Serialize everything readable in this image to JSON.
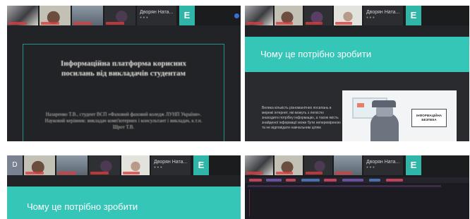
{
  "panels": [
    {
      "strip": {
        "name_label": "Дворян Ната...",
        "e_label": "E"
      },
      "slide": {
        "title": "Інформаційна платформа корисних посилань від викладачів студентам",
        "authors": "Назаренко Т.В., студент ВСП «Фаховий фаховий коледж ЛУНП України». Науковий керівник: викладач комп'ютерних і консультант і викладач, к.т.н. Шрот Т.В."
      }
    },
    {
      "strip": {
        "name_label": "Дворян Ната...",
        "e_label": "E"
      },
      "slide": {
        "heading": "Чому це потрібно зробити",
        "paragraph": "Велика кількість різноманітних посилань в мережі інтернет, які можуть з легкістю знаходити потрібну інформацію, а також якість знайденої інформації може бути неперевіреною та не відповідати навчальним цілям",
        "badge": "ІНФОРМАЦІЙНА БЕЗПЕКА"
      }
    },
    {
      "strip": {
        "name_label": "Дворян Ната...",
        "e_label": "E",
        "d_label": "D"
      },
      "slide": {
        "heading": "Чому це потрібно зробити"
      }
    },
    {
      "strip": {
        "name_label": "Дворян Ната...",
        "e_label": "E"
      }
    }
  ],
  "colors": {
    "teal": "#35c6b7",
    "dark": "#222326",
    "accent_blue": "#3a6fd8"
  }
}
